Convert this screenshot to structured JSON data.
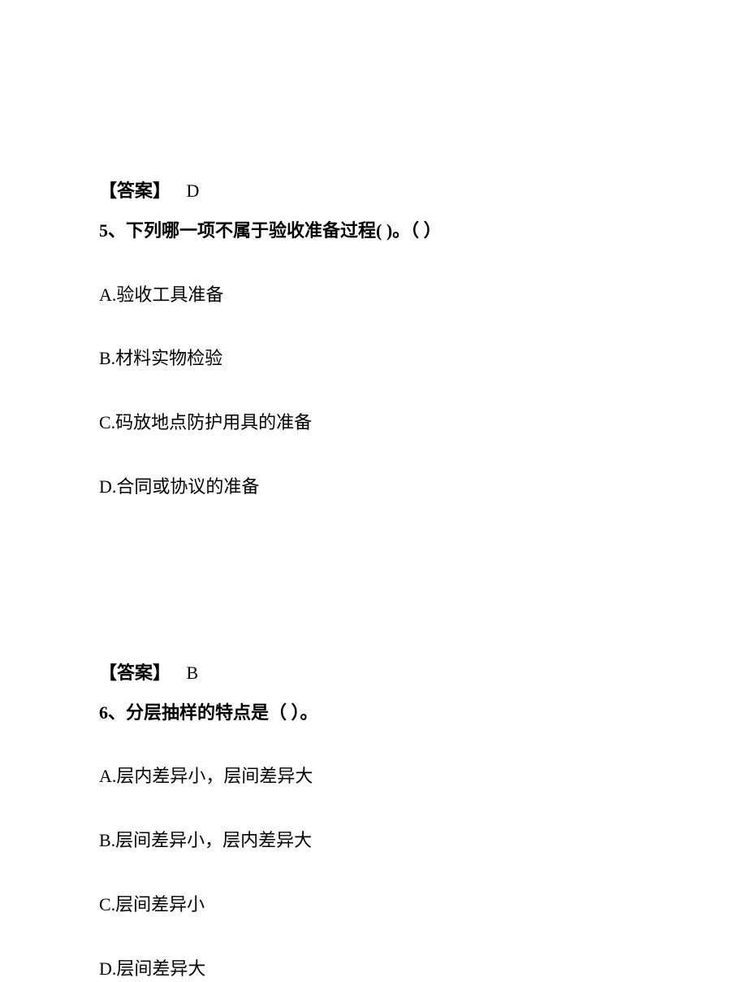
{
  "block1": {
    "answer_label": "【答案】",
    "answer_value": "D",
    "question": "5、下列哪一项不属于验收准备过程( )。（ ）",
    "options": {
      "A": "A.验收工具准备",
      "B": "B.材料实物检验",
      "C": "C.码放地点防护用具的准备",
      "D": "D.合同或协议的准备"
    }
  },
  "block2": {
    "answer_label": "【答案】",
    "answer_value": "B",
    "question": "6、分层抽样的特点是（ ）。",
    "options": {
      "A": "A.层内差异小，层间差异大",
      "B": "B.层间差异小，层内差异大",
      "C": "C.层间差异小",
      "D": "D.层间差异大"
    }
  }
}
